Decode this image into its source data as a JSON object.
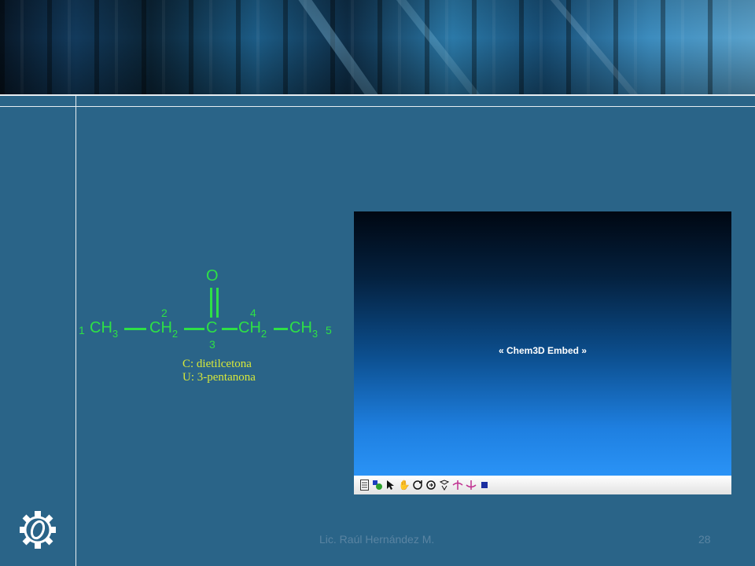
{
  "formula": {
    "groups": [
      {
        "main": "CH",
        "sub": "3"
      },
      {
        "main": "CH",
        "sub": "2"
      },
      {
        "main": "C",
        "sub": ""
      },
      {
        "main": "CH",
        "sub": "2"
      },
      {
        "main": "CH",
        "sub": "3"
      }
    ],
    "oxygen": "O",
    "numbers": [
      "1",
      "2",
      "3",
      "4",
      "5"
    ],
    "common_name": "C: dietilcetona",
    "iupac_name": "U: 3-pentanona"
  },
  "embed": {
    "label": "« Chem3D Embed »",
    "tools": [
      "document-icon",
      "model-icon",
      "pointer-icon",
      "hand-icon",
      "rotate-icon",
      "zoom-icon",
      "trackball-icon",
      "x-rotate-icon",
      "y-rotate-icon",
      "stop-icon"
    ]
  },
  "footer": {
    "author": "Lic. Raúl Hernández M.",
    "page": "28"
  },
  "colors": {
    "background": "#2a6488",
    "formula_green": "#2ee046",
    "names_yellow": "#d7e83a",
    "footer_text": "#5a84a2"
  }
}
